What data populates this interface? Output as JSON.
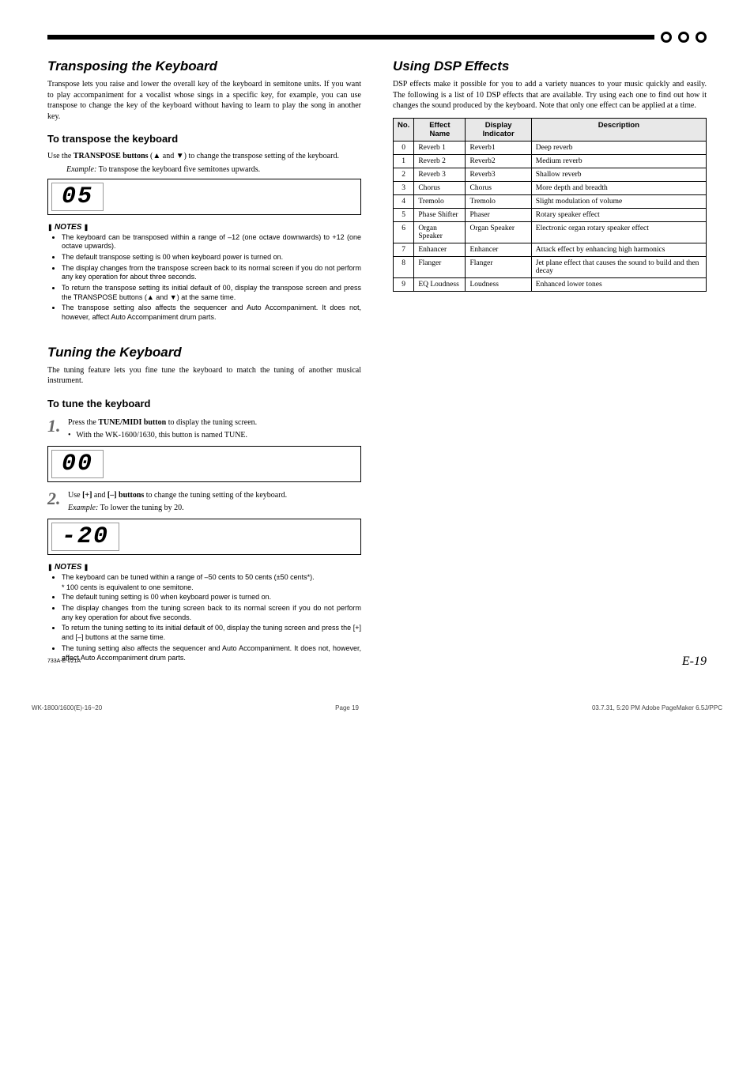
{
  "header": {},
  "left": {
    "s1": {
      "title": "Transposing the Keyboard",
      "intro": "Transpose lets you raise and lower the overall key of the keyboard in semitone units. If you want to play accompaniment for a vocalist whose sings in a specific key, for example, you can use transpose to change the key of the keyboard without having to learn to play the song in another key.",
      "sub": "To transpose the keyboard",
      "use_line": "Use the TRANSPOSE buttons (▲ and ▼) to change the transpose setting of the keyboard.",
      "example_label": "Example:",
      "example_text": "To transpose the keyboard five semitones upwards.",
      "display": "05",
      "notes_label": "NOTES",
      "notes": [
        "The keyboard can be transposed within a range of –12 (one octave downwards) to +12 (one octave upwards).",
        "The default transpose setting is 00 when keyboard power is turned on.",
        "The display changes from the transpose screen back to its normal screen if you do not perform any key operation for about three seconds.",
        "To return the transpose setting its initial default of 00, display the transpose screen and press the TRANSPOSE buttons (▲ and ▼) at the same time.",
        "The transpose setting also affects the sequencer and Auto Accompaniment. It does not, however, affect Auto Accompaniment drum parts."
      ]
    },
    "s2": {
      "title": "Tuning the Keyboard",
      "intro": "The tuning feature lets you fine tune the keyboard to match the tuning of another musical instrument.",
      "sub": "To tune the keyboard",
      "step1": {
        "num": "1.",
        "text_a": "Press the ",
        "bold": "TUNE/MIDI button",
        "text_b": " to display the tuning screen.",
        "sub": "With the WK-1600/1630, this button is named TUNE.",
        "display": "00"
      },
      "step2": {
        "num": "2.",
        "text_a": "Use ",
        "bold1": "[+]",
        "text_b": " and ",
        "bold2": "[–] buttons",
        "text_c": " to change the tuning setting of the keyboard.",
        "example_label": "Example:",
        "example_text": "To lower the tuning by 20.",
        "display": "-20"
      },
      "notes_label": "NOTES",
      "notes": [
        "The keyboard can be tuned within a range of –50 cents to 50 cents (±50 cents*).",
        "The default tuning setting is 00 when keyboard power is turned on.",
        "The display changes from the tuning screen back to its normal screen if you do not perform any key operation for about five seconds.",
        "To return the tuning setting to its initial default of 00, display the tuning screen and press the [+] and [–] buttons at the same time.",
        "The tuning setting also affects the sequencer and Auto Accompaniment. It does not, however, affect Auto Accompaniment drum parts."
      ],
      "subnote": "* 100 cents is equivalent to one semitone."
    }
  },
  "right": {
    "title": "Using DSP Effects",
    "intro": "DSP effects make it possible for you to add a variety nuances to your music quickly and easily. The following is a list of 10 DSP effects that are available. Try using each one to find out how it changes the sound produced by the keyboard. Note that only one effect can be applied at a time.",
    "thead": {
      "c1": "No.",
      "c2": "Effect Name",
      "c3": "Display Indicator",
      "c4": "Description"
    },
    "rows": [
      {
        "no": "0",
        "name": "Reverb 1",
        "ind": "Reverb1",
        "desc": "Deep reverb"
      },
      {
        "no": "1",
        "name": "Reverb 2",
        "ind": "Reverb2",
        "desc": "Medium reverb"
      },
      {
        "no": "2",
        "name": "Reverb 3",
        "ind": "Reverb3",
        "desc": "Shallow reverb"
      },
      {
        "no": "3",
        "name": "Chorus",
        "ind": "Chorus",
        "desc": "More depth and breadth"
      },
      {
        "no": "4",
        "name": "Tremolo",
        "ind": "Tremolo",
        "desc": "Slight modulation of volume"
      },
      {
        "no": "5",
        "name": "Phase Shifter",
        "ind": "Phaser",
        "desc": "Rotary speaker effect"
      },
      {
        "no": "6",
        "name": "Organ Speaker",
        "ind": "Organ Speaker",
        "desc": "Electronic organ rotary speaker effect"
      },
      {
        "no": "7",
        "name": "Enhancer",
        "ind": "Enhancer",
        "desc": "Attack effect by enhancing high harmonics"
      },
      {
        "no": "8",
        "name": "Flanger",
        "ind": "Flanger",
        "desc": "Jet plane effect that causes the sound to build and then decay"
      },
      {
        "no": "9",
        "name": "EQ Loudness",
        "ind": "Loudness",
        "desc": "Enhanced lower tones"
      }
    ]
  },
  "footer": {
    "code": "733A-E-021A",
    "page": "E-19",
    "print_left": "WK-1800/1600(E)-16~20",
    "print_page": "Page 19",
    "print_right": "03.7.31, 5:20 PM   Adobe PageMaker 6.5J/PPC"
  }
}
